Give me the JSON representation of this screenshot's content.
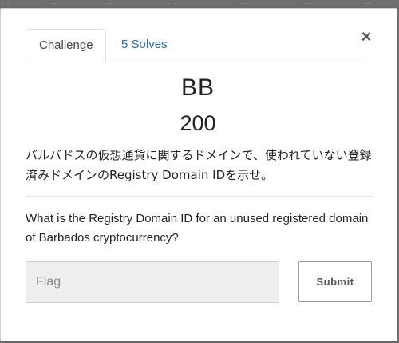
{
  "backdrop": {
    "fragments": [
      "…",
      "…",
      "…",
      "…",
      "…",
      "…",
      "…"
    ]
  },
  "modal": {
    "close_glyph": "×",
    "tabs": [
      {
        "label": "Challenge",
        "active": true
      },
      {
        "label": "5 Solves",
        "active": false
      }
    ],
    "challenge": {
      "name": "BB",
      "value": "200",
      "description_jp": "バルバドスの仮想通貨に関するドメインで、使われていない登録済みドメインのRegistry Domain IDを示せ。",
      "description_en": "What is the Registry Domain ID for an unused registered domain of Barbados cryptocurrency?"
    },
    "form": {
      "flag_placeholder": "Flag",
      "flag_value": "",
      "submit_label": "Submit"
    }
  },
  "colors": {
    "tab_link": "#2a6fa8",
    "text": "#222222",
    "input_bg": "#eeeeee",
    "backdrop": "#7b7b7b"
  }
}
